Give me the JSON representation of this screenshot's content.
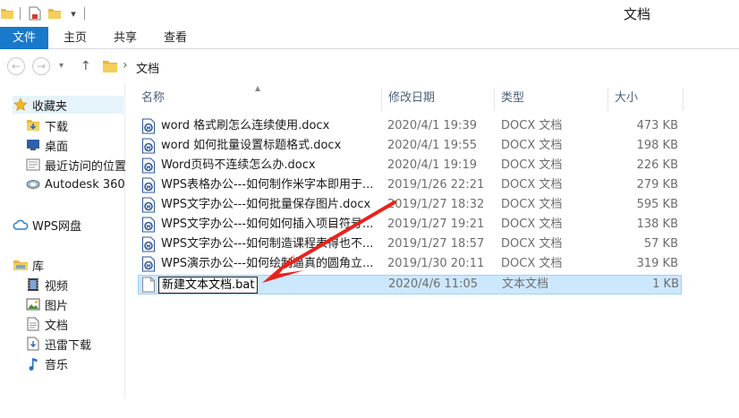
{
  "window": {
    "title": "文档"
  },
  "quick_access": {
    "icons": [
      "folder-icon",
      "properties-icon",
      "new-folder-icon",
      "customize-dropdown-icon"
    ],
    "customize_glyph": "▾"
  },
  "ribbon": {
    "tabs": [
      {
        "label": "文件",
        "active": true
      },
      {
        "label": "主页",
        "active": false
      },
      {
        "label": "共享",
        "active": false
      },
      {
        "label": "查看",
        "active": false
      }
    ]
  },
  "address_bar": {
    "back_glyph": "←",
    "forward_glyph": "→",
    "history_glyph": "▾",
    "up_glyph": "↑",
    "separator_glyph": "›",
    "location": "文档"
  },
  "navigation": {
    "favorites": {
      "label": "收藏夹",
      "icon": "star-icon",
      "items": [
        {
          "label": "下载",
          "icon": "downloads-folder-icon"
        },
        {
          "label": "桌面",
          "icon": "desktop-icon"
        },
        {
          "label": "最近访问的位置",
          "icon": "recent-places-icon"
        },
        {
          "label": "Autodesk 360",
          "icon": "autodesk-360-icon"
        }
      ]
    },
    "cloud": {
      "label": "WPS网盘",
      "icon": "cloud-icon"
    },
    "library": {
      "label": "库",
      "icon": "library-icon",
      "items": [
        {
          "label": "视频",
          "icon": "video-library-icon"
        },
        {
          "label": "图片",
          "icon": "pictures-library-icon"
        },
        {
          "label": "文档",
          "icon": "documents-library-icon"
        },
        {
          "label": "迅雷下载",
          "icon": "thunder-download-icon"
        },
        {
          "label": "音乐",
          "icon": "music-library-icon"
        }
      ]
    }
  },
  "file_list": {
    "columns": {
      "name": "名称",
      "date": "修改日期",
      "type": "类型",
      "size": "大小"
    },
    "sort_glyph": "▲",
    "rows": [
      {
        "name": "word 格式刷怎么连续使用.docx",
        "date": "2020/4/1 19:39",
        "type": "DOCX 文档",
        "size": "473 KB",
        "icon": "docx-icon"
      },
      {
        "name": "word 如何批量设置标题格式.docx",
        "date": "2020/4/1 19:55",
        "type": "DOCX 文档",
        "size": "198 KB",
        "icon": "docx-icon"
      },
      {
        "name": "Word页码不连续怎么办.docx",
        "date": "2020/4/1 19:19",
        "type": "DOCX 文档",
        "size": "226 KB",
        "icon": "docx-icon"
      },
      {
        "name": "WPS表格办公---如何制作米字本即用于...",
        "date": "2019/1/26 22:21",
        "type": "DOCX 文档",
        "size": "279 KB",
        "icon": "docx-icon"
      },
      {
        "name": "WPS文字办公---如何批量保存图片.docx",
        "date": "2019/1/27 18:32",
        "type": "DOCX 文档",
        "size": "595 KB",
        "icon": "docx-icon"
      },
      {
        "name": "WPS文字办公---如何如何插入项目符号...",
        "date": "2019/1/27 19:21",
        "type": "DOCX 文档",
        "size": "138 KB",
        "icon": "docx-icon"
      },
      {
        "name": "WPS文字办公---如何制造课程表得也不...",
        "date": "2019/1/27 18:57",
        "type": "DOCX 文档",
        "size": "57 KB",
        "icon": "docx-icon"
      },
      {
        "name": "WPS演示办公---如何绘制逼真的圆角立...",
        "date": "2019/1/30 20:11",
        "type": "DOCX 文档",
        "size": "319 KB",
        "icon": "docx-icon"
      }
    ],
    "renaming_row": {
      "name": "新建文本文档.bat",
      "date": "2020/4/6 11:05",
      "type": "文本文档",
      "size": "1 KB",
      "icon": "text-file-icon"
    }
  },
  "colors": {
    "file_tab": "#1979ca",
    "selection": "#cce8ff",
    "header_text": "#4c607a",
    "annotation_arrow": "#e8221b"
  }
}
